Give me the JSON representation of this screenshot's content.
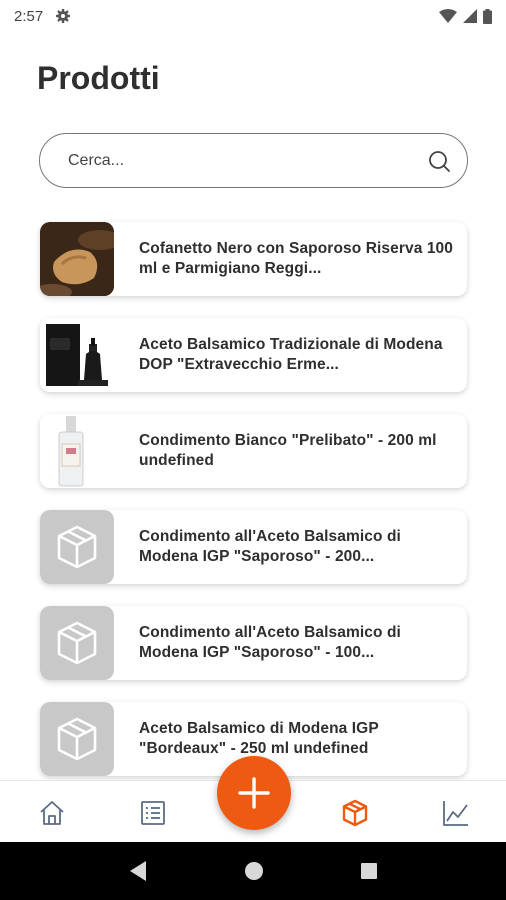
{
  "status_bar": {
    "time": "2:57"
  },
  "header": {
    "title": "Prodotti"
  },
  "search": {
    "placeholder": "Cerca..."
  },
  "products": [
    {
      "name": "Cofanetto Nero con Saporoso Riserva 100 ml e Parmigiano Reggi...",
      "image": "cheese-photo"
    },
    {
      "name": "Aceto Balsamico Tradizionale di Modena DOP \"Extravecchio Erme...",
      "image": "black-box-bottle-photo"
    },
    {
      "name": "Condimento Bianco \"Prelibato\" - 200 ml undefined",
      "image": "white-bottle-photo"
    },
    {
      "name": "Condimento all'Aceto Balsamico di Modena IGP \"Saporoso\" - 200...",
      "image": "box-placeholder-icon"
    },
    {
      "name": "Condimento all'Aceto Balsamico di Modena IGP \"Saporoso\" - 100...",
      "image": "box-placeholder-icon"
    },
    {
      "name": "Aceto Balsamico di Modena IGP \"Bordeaux\" - 250 ml undefined",
      "image": "box-placeholder-icon"
    }
  ],
  "bottom_nav": {
    "items": [
      "home-icon",
      "list-icon",
      "box-icon",
      "chart-icon"
    ],
    "active": "box-icon"
  },
  "colors": {
    "accent": "#ee5a12",
    "inactive_icon": "#5a6b86",
    "placeholder_bg": "#c8c8c8"
  }
}
